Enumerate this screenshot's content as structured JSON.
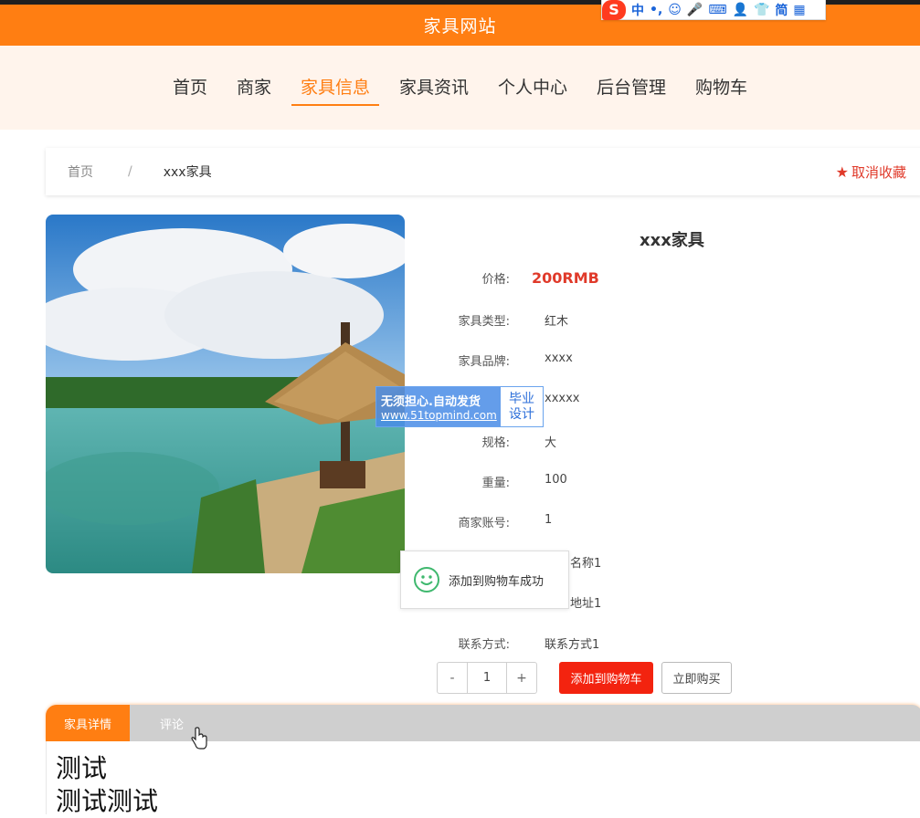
{
  "header": {
    "title": "家具网站"
  },
  "ime_toolbar": {
    "logo": "S",
    "items": [
      "中",
      "•,",
      "☺",
      "🎤",
      "⌨",
      "👤",
      "👕",
      "简",
      "▦"
    ]
  },
  "nav": {
    "items": [
      {
        "label": "首页"
      },
      {
        "label": "商家"
      },
      {
        "label": "家具信息",
        "active": true
      },
      {
        "label": "家具资讯"
      },
      {
        "label": "个人中心"
      },
      {
        "label": "后台管理"
      },
      {
        "label": "购物车"
      }
    ]
  },
  "breadcrumb": {
    "home": "首页",
    "sep": "/",
    "current": "xxx家具",
    "fav_label": "取消收藏"
  },
  "product": {
    "title": "xxx家具",
    "fields": [
      {
        "label": "价格:",
        "value": "200RMB",
        "type": "price"
      },
      {
        "label": "家具类型:",
        "value": "红木"
      },
      {
        "label": "家具品牌:",
        "value": "xxxx"
      },
      {
        "label": "",
        "value": "xxxxx"
      },
      {
        "label": "规格:",
        "value": "大"
      },
      {
        "label": "重量:",
        "value": "100"
      },
      {
        "label": "商家账号:",
        "value": "1"
      },
      {
        "label": "",
        "value": "名称1"
      },
      {
        "label": "",
        "value": "地址1"
      },
      {
        "label": "联系方式:",
        "value": "联系方式1"
      }
    ]
  },
  "actions": {
    "minus": "-",
    "quantity": "1",
    "plus": "+",
    "add_to_cart": "添加到购物车",
    "buy_now": "立即购买"
  },
  "watermark": {
    "line1": "无须担心.自动发货",
    "line2": "www.51topmind.com",
    "badge1": "毕业",
    "badge2": "设计"
  },
  "toast": {
    "message": "添加到购物车成功"
  },
  "tabs": {
    "items": [
      {
        "label": "家具详情",
        "active": true
      },
      {
        "label": "评论"
      }
    ]
  },
  "detail": {
    "lines": [
      "测试",
      "测试测试"
    ]
  }
}
